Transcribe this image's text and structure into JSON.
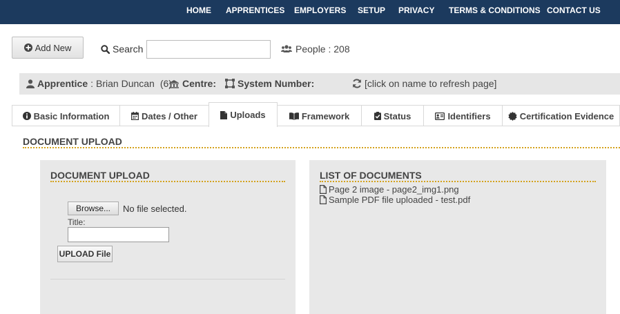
{
  "nav": {
    "items": [
      {
        "label": "HOME"
      },
      {
        "label": "APPRENTICES"
      },
      {
        "label": "EMPLOYERS"
      },
      {
        "label": "SETUP"
      },
      {
        "label": "PRIVACY"
      },
      {
        "label": "TERMS & CONDITIONS"
      },
      {
        "label": "CONTACT US"
      }
    ],
    "background": "#1c3a5e"
  },
  "toolbar": {
    "add_new_label": "Add New",
    "search_label": "Search :",
    "search_value": "",
    "people_label": "People : 208"
  },
  "infobar": {
    "apprentice_label": "Apprentice",
    "apprentice_sep": ":",
    "apprentice_name": "Brian Duncan",
    "apprentice_count": "(6)",
    "centre_label": "Centre:",
    "system_number_label": "System Number:",
    "refresh_hint": "[click on name to refresh page]"
  },
  "tabs": [
    {
      "label": "Basic Information",
      "icon": "info-circle-icon",
      "active": false
    },
    {
      "label": "Dates / Other",
      "icon": "calendar-icon",
      "active": false
    },
    {
      "label": "Uploads",
      "icon": "file-icon",
      "active": true
    },
    {
      "label": "Framework",
      "icon": "book-icon",
      "active": false
    },
    {
      "label": "Status",
      "icon": "clipboard-check-icon",
      "active": false
    },
    {
      "label": "Identifiers",
      "icon": "id-card-icon",
      "active": false
    },
    {
      "label": "Certification Evidence",
      "icon": "badge-icon",
      "active": false
    }
  ],
  "section_title": "DOCUMENT UPLOAD",
  "upload_panel": {
    "title": "DOCUMENT UPLOAD",
    "browse_label": "Browse...",
    "file_status": "No file selected.",
    "title_field_label": "Title:",
    "title_field_value": "",
    "upload_button_label": "UPLOAD File"
  },
  "documents_panel": {
    "title": "LIST OF DOCUMENTS",
    "documents": [
      "Page 2 image - page2_img1.png",
      "Sample PDF file uploaded - test.pdf"
    ]
  },
  "colors": {
    "nav_bg": "#1c3a5e",
    "accent_dotted": "#d4a11a",
    "panel_bg": "#e8e8e8",
    "infobar_bg": "#e6e6e6"
  }
}
